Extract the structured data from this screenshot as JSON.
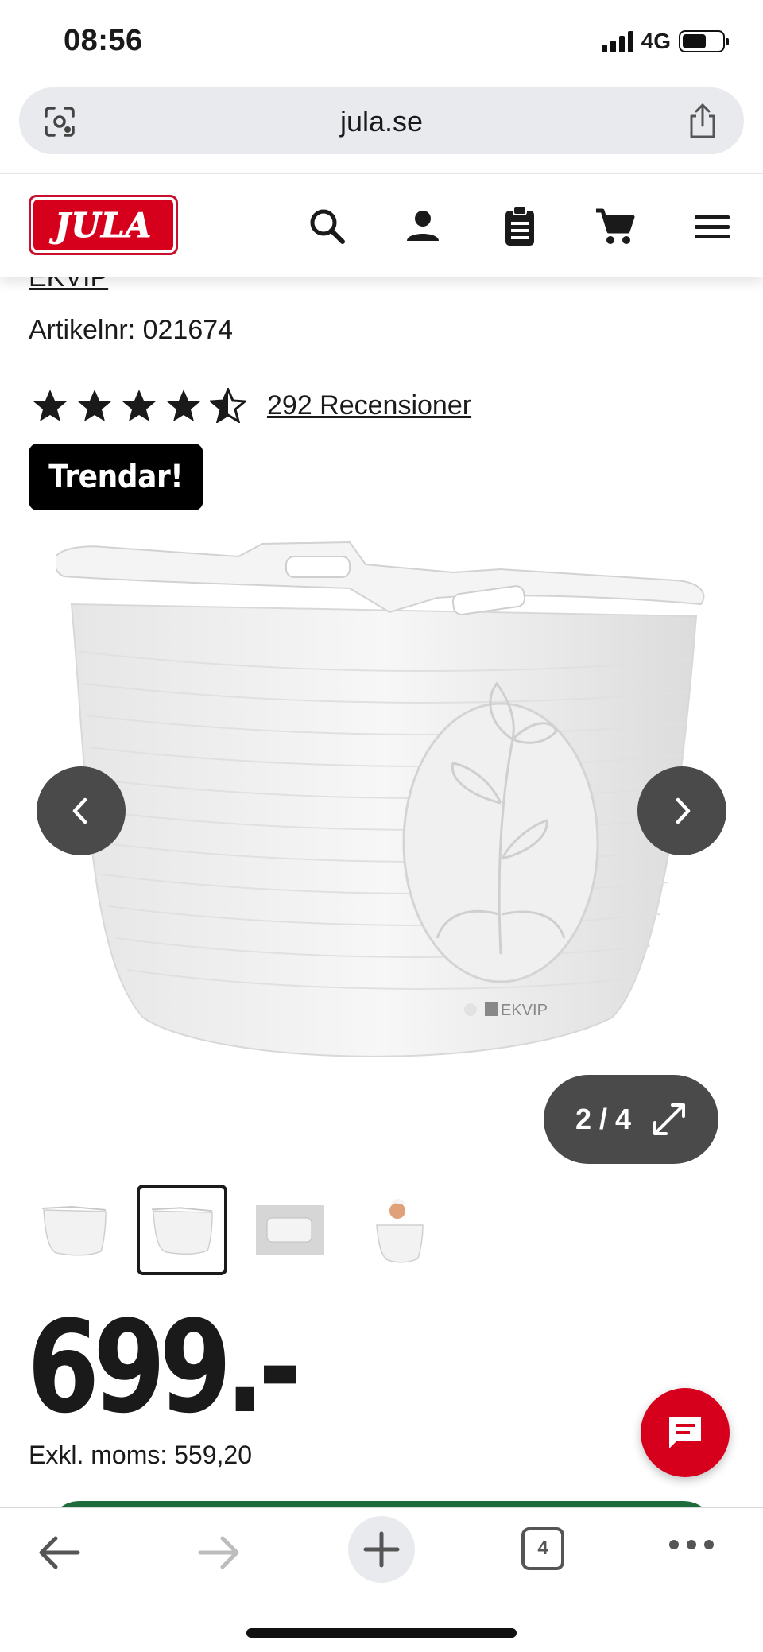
{
  "status": {
    "time": "08:56",
    "network": "4G"
  },
  "browser": {
    "url": "jula.se",
    "tab_count": "4"
  },
  "header": {
    "logo_text": "JULA"
  },
  "product": {
    "brand_partial": "EKVIP",
    "article_number": "Artikelnr: 021674",
    "rating": 4.5,
    "reviews_label": "292 Recensioner",
    "badge": "Trendar!",
    "image_counter": "2 / 4",
    "image_brand_mark": "EKVIP",
    "price": "699.-",
    "vat_text": "Exkl. moms: 559,20"
  },
  "colors": {
    "brand_red": "#d6001c",
    "dark_gray": "#4a4a4a",
    "green": "#1f6b3a"
  }
}
